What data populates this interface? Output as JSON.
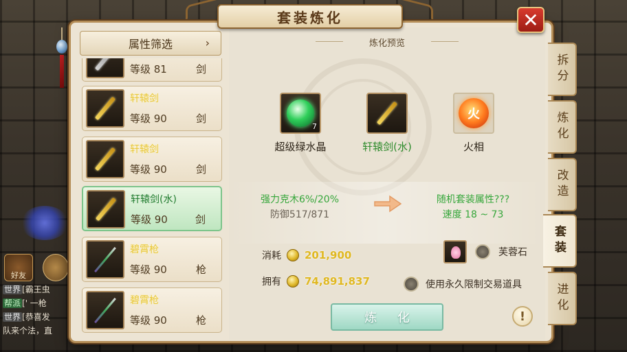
{
  "dialog": {
    "title": "套装炼化",
    "close_label": "✕"
  },
  "filter": {
    "label": "属性筛选",
    "chevron": "›"
  },
  "items": [
    {
      "name": "",
      "level": "等级 81",
      "type": "剑",
      "icon": "sword-icon"
    },
    {
      "name": "轩辕剑",
      "level": "等级 90",
      "type": "剑",
      "icon": "sword-icon"
    },
    {
      "name": "轩辕剑",
      "level": "等级 90",
      "type": "剑",
      "icon": "sword-icon"
    },
    {
      "name": "轩辕剑(水)",
      "level": "等级 90",
      "type": "剑",
      "icon": "sword-icon",
      "selected": true
    },
    {
      "name": "碧霄枪",
      "level": "等级 90",
      "type": "枪",
      "icon": "spear-icon"
    },
    {
      "name": "碧霄枪",
      "level": "等级 90",
      "type": "枪",
      "icon": "spear-icon"
    }
  ],
  "preview": {
    "label": "炼化预览",
    "materials": [
      {
        "label": "超级绿水晶",
        "count": "7",
        "icon": "green-crystal-icon"
      },
      {
        "label": "轩辕剑(水)",
        "icon": "sword-icon"
      },
      {
        "label": "火相",
        "icon": "fire-element-icon",
        "glyph": "火"
      }
    ],
    "current_attr": {
      "line1": "强力克木6%/20%",
      "line2": "防御517/871"
    },
    "result_attr": {
      "line1": "随机套装属性???",
      "line2": "速度 18 ~ 73"
    }
  },
  "cost": {
    "label": "消耗",
    "amount": "201,900"
  },
  "owned": {
    "label": "拥有",
    "amount": "74,891,837"
  },
  "options": {
    "furong_label": "芙蓉石",
    "permanent_label": "使用永久限制交易道具"
  },
  "refine_button": "炼 化",
  "help_button": "!",
  "tabs": [
    {
      "label": "拆分"
    },
    {
      "label": "炼化"
    },
    {
      "label": "改造"
    },
    {
      "label": "套装",
      "active": true
    },
    {
      "label": "进化"
    }
  ],
  "background": {
    "friends_label": "好友",
    "chat": [
      {
        "tag": "世界",
        "tag_style": "world",
        "text": "[霸王虫"
      },
      {
        "tag": "帮派",
        "tag_style": "gang",
        "text": "[' 一枪"
      },
      {
        "tag": "世界",
        "tag_style": "world",
        "text": "[恭喜发"
      },
      {
        "tag": "",
        "tag_style": "",
        "text": "队来个法，直"
      }
    ]
  },
  "colors": {
    "gold_text": "#e8c63a",
    "green_text": "#35a63a",
    "close_red": "#d83b2e",
    "money_gold": "#e0b821"
  }
}
